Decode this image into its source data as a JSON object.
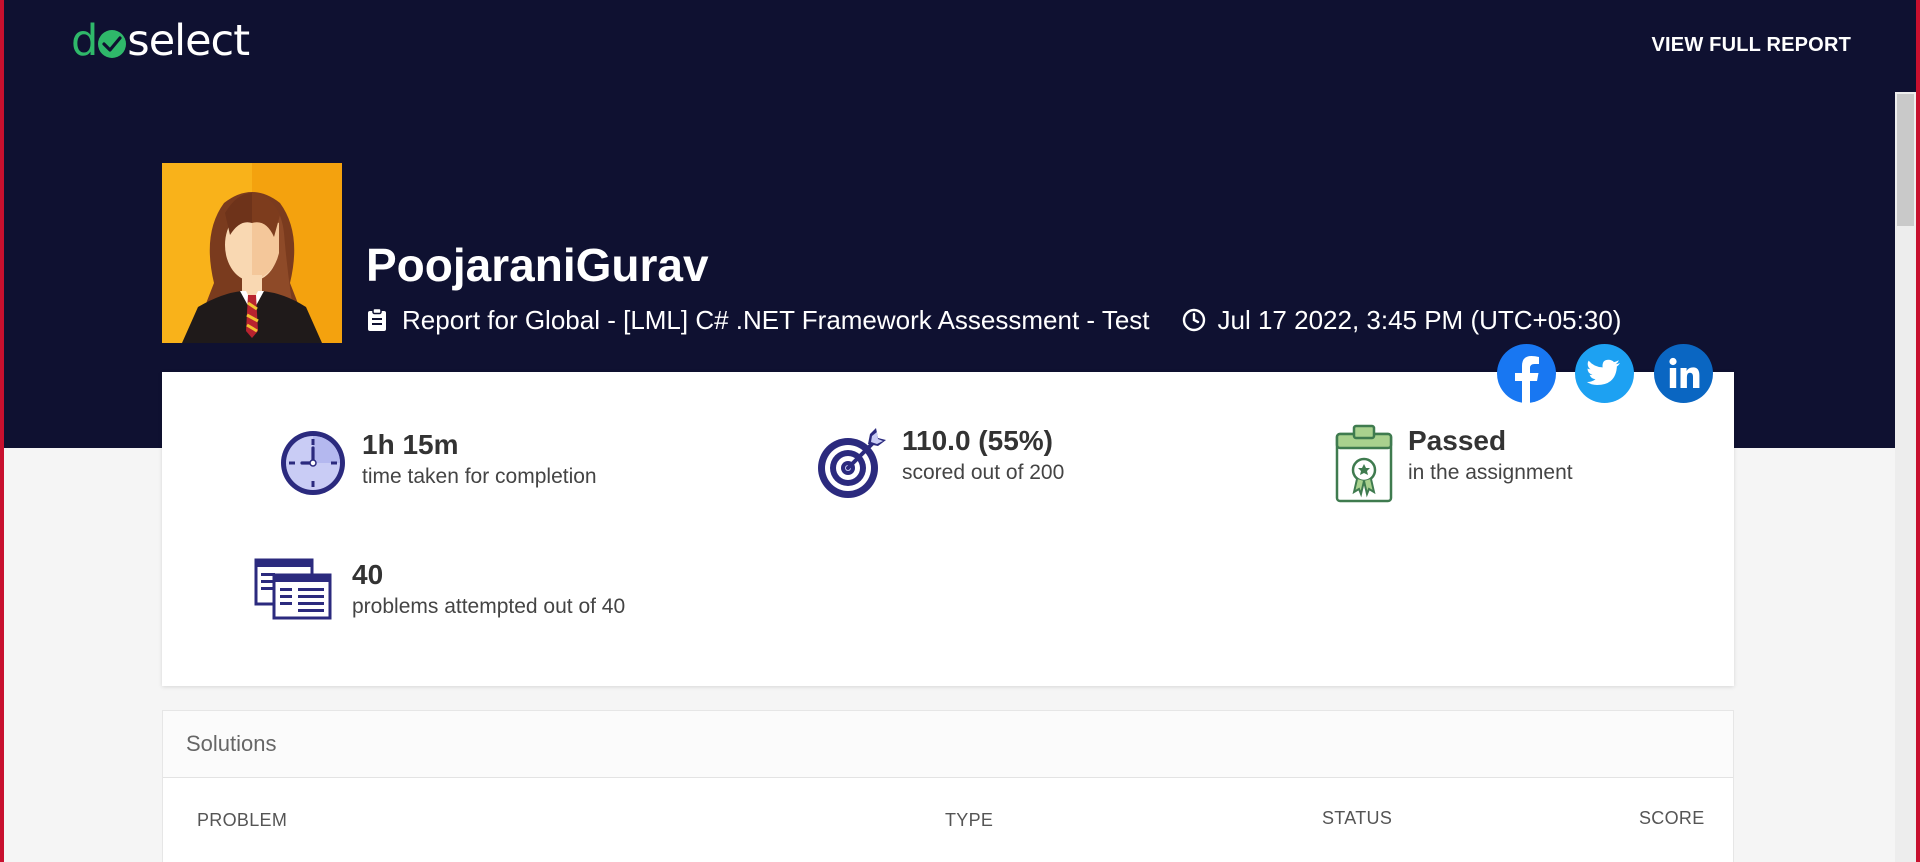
{
  "header": {
    "logo": {
      "prefix": "d",
      "suffix": "select"
    },
    "view_full_report": "VIEW FULL REPORT"
  },
  "profile": {
    "name": "PoojaraniGurav",
    "report_title": "Report for Global - [LML] C# .NET Framework Assessment - Test",
    "datetime": "Jul 17 2022, 3:45 PM (UTC+05:30)"
  },
  "social": [
    "facebook-icon",
    "twitter-icon",
    "linkedin-icon"
  ],
  "stats": {
    "time": {
      "value": "1h 15m",
      "label": "time taken for completion"
    },
    "score": {
      "value": "110.0 (55%)",
      "label": "scored out of 200"
    },
    "result": {
      "value": "Passed",
      "label": "in the assignment"
    },
    "problems": {
      "value": "40",
      "label": "problems attempted out of 40"
    }
  },
  "solutions": {
    "title": "Solutions",
    "columns": [
      "PROBLEM",
      "TYPE",
      "STATUS",
      "SCORE"
    ]
  },
  "colors": {
    "hero_bg": "#0f1131",
    "brand_green": "#2fb86a",
    "icon_purple": "#2b2a7e",
    "frame_red": "#c8102e"
  }
}
